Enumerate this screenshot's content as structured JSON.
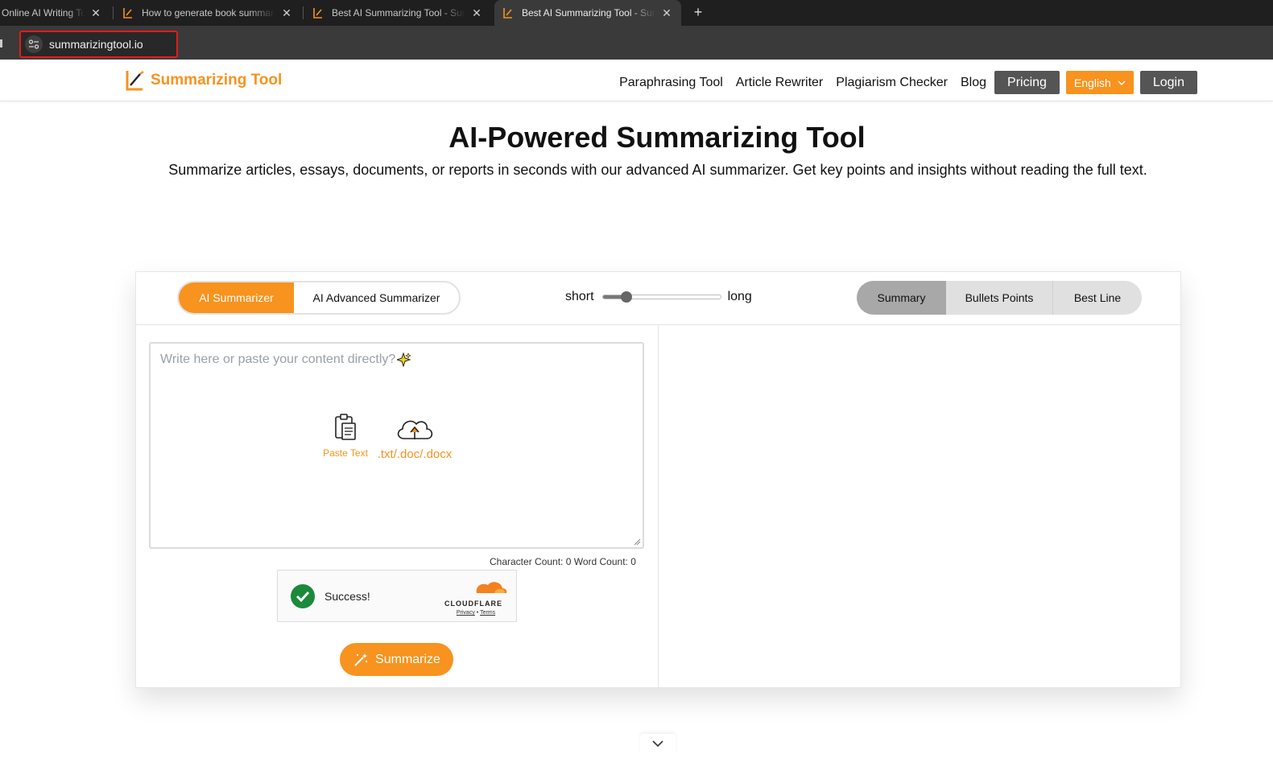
{
  "browser": {
    "tabs": [
      {
        "title": "Online AI Writing Tools",
        "active": false
      },
      {
        "title": "How to generate book summaries",
        "active": false
      },
      {
        "title": "Best AI Summarizing Tool - Summarizing Tool",
        "active": false
      },
      {
        "title": "Best AI Summarizing Tool - Summarizing Tool",
        "active": true
      }
    ],
    "new_tab_label": "+",
    "url": "summarizingtool.io"
  },
  "header": {
    "logo_text": "Summarizing Tool",
    "nav": {
      "paraphrasing": "Paraphrasing Tool",
      "article_rewriter": "Article Rewriter",
      "plagiarism": "Plagiarism Checker",
      "blog": "Blog",
      "pricing": "Pricing",
      "language": "English",
      "login": "Login"
    }
  },
  "hero": {
    "title": "AI-Powered Summarizing Tool",
    "subtitle": "Summarize articles, essays, documents, or reports in seconds with our advanced AI summarizer. Get key points and insights without reading the full text."
  },
  "tool": {
    "modes": {
      "basic": "AI Summarizer",
      "advanced": "AI Advanced Summarizer",
      "selected": "AI Summarizer"
    },
    "length": {
      "min_label": "short",
      "max_label": "long",
      "value": 0.2
    },
    "output_modes": {
      "summary": "Summary",
      "bullets": "Bullets Points",
      "best_line": "Best Line",
      "selected": "Summary"
    },
    "input": {
      "placeholder": "Write here or paste your content directly?",
      "paste_label": "Paste Text",
      "upload_label": ".txt/.doc/.docx"
    },
    "counts": "Character Count: 0 Word Count: 0",
    "captcha": {
      "status": "Success!",
      "brand": "CLOUDFLARE",
      "privacy": "Privacy",
      "sep": "•",
      "terms": "Terms"
    },
    "submit_label": "Summarize"
  },
  "colors": {
    "accent": "#f7931e",
    "dark_button": "#555555",
    "success": "#1a8a3a"
  }
}
